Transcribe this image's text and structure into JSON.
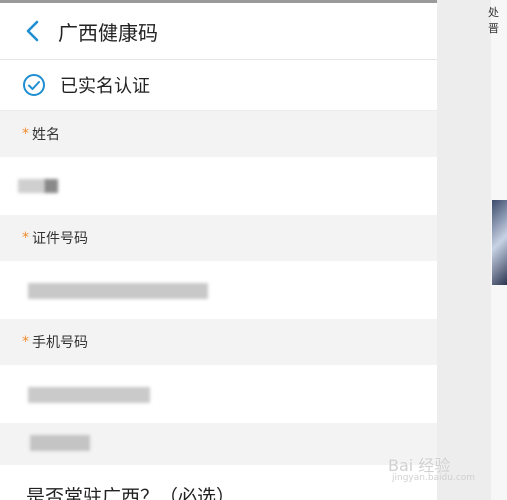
{
  "header": {
    "title": "广西健康码"
  },
  "verified": {
    "text": "已实名认证"
  },
  "form": {
    "required_mark": "*",
    "name_label": "姓名",
    "id_label": "证件号码",
    "phone_label": "手机号码",
    "question": "是否常驻广西？（必选）"
  },
  "side": {
    "top_text": "处晋"
  },
  "watermark": {
    "text": "Bai 经验",
    "url": "jingyan.baidu.com"
  },
  "colors": {
    "accent": "#1f8fd1",
    "required": "#f08a2c"
  }
}
